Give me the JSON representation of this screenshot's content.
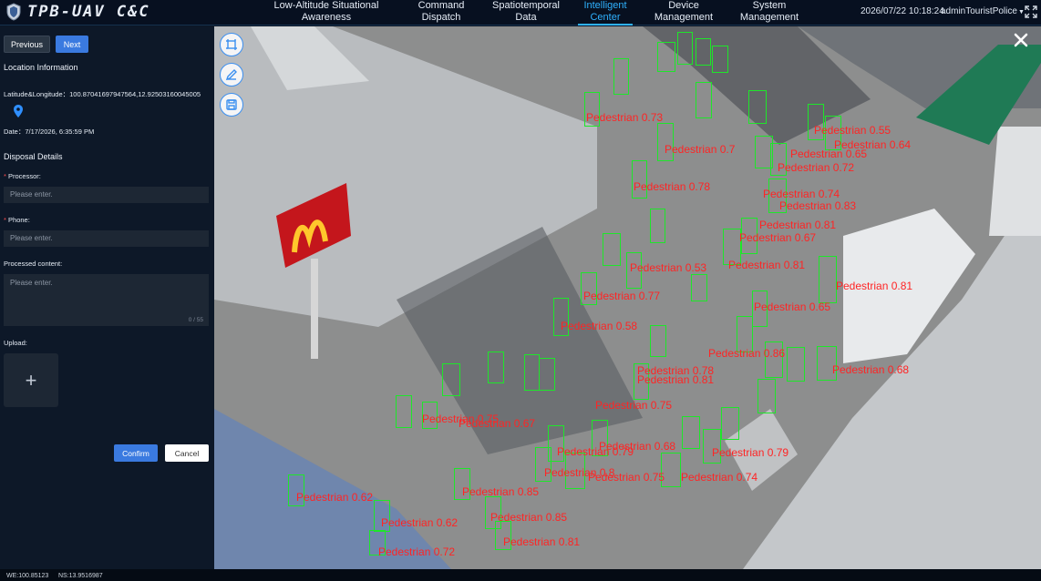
{
  "header": {
    "logo_text": "TPB-UAV  C&C",
    "nav": [
      {
        "line1": "Low-Altitude Situational",
        "line2": "Awareness"
      },
      {
        "line1": "Command",
        "line2": "Dispatch"
      },
      {
        "line1": "Spatiotemporal",
        "line2": "Data"
      },
      {
        "line1": "Intelligent",
        "line2": "Center"
      },
      {
        "line1": "Device",
        "line2": "Management"
      },
      {
        "line1": "System",
        "line2": "Management"
      }
    ],
    "datetime": "2026/07/22 10:18:24",
    "user": "adminTouristPolice"
  },
  "sidebar": {
    "prev_label": "Previous",
    "next_label": "Next",
    "location_title": "Location Information",
    "latlng_label": "Latitude&Longitude：",
    "latlng_value": "100.87041697947564,12.92503160045005",
    "date_label": "Date：",
    "date_value": "7/17/2026, 6:35:59 PM",
    "disposal_title": "Disposal Details",
    "processor_label": "Processor:",
    "processor_placeholder": "Please enter.",
    "phone_label": "Phone:",
    "phone_placeholder": "Please enter.",
    "content_label": "Processed content:",
    "content_placeholder": "Please enter.",
    "content_counter": "0 / 55",
    "upload_label": "Upload:",
    "upload_plus": "+",
    "confirm_label": "Confirm",
    "cancel_label": "Cancel"
  },
  "footer": {
    "we": "WE:100.85123",
    "ns": "NS:13.9516987"
  },
  "video": {
    "detections": [
      {
        "label": "Pedestrian 0.73"
      },
      {
        "label": "Pedestrian 0.7"
      },
      {
        "label": "Pedestrian 0.78"
      },
      {
        "label": "Pedestrian 0.55"
      },
      {
        "label": "Pedestrian 0.64"
      },
      {
        "label": "Pedestrian 0.65"
      },
      {
        "label": "Pedestrian 0.72"
      },
      {
        "label": "Pedestrian 0.74"
      },
      {
        "label": "Pedestrian 0.83"
      },
      {
        "label": "Pedestrian 0.81"
      },
      {
        "label": "Pedestrian 0.67"
      },
      {
        "label": "Pedestrian 0.53"
      },
      {
        "label": "Pedestrian 0.81"
      },
      {
        "label": "Pedestrian 0.77"
      },
      {
        "label": "Pedestrian 0.81"
      },
      {
        "label": "Pedestrian 0.65"
      },
      {
        "label": "Pedestrian 0.58"
      },
      {
        "label": "Pedestrian 0.86"
      },
      {
        "label": "Pedestrian 0.78"
      },
      {
        "label": "Pedestrian 0.81"
      },
      {
        "label": "Pedestrian 0.68"
      },
      {
        "label": "Pedestrian 0.75"
      },
      {
        "label": "Pedestrian 0.67"
      },
      {
        "label": "Pedestrian 0.75"
      },
      {
        "label": "Pedestrian 0.79"
      },
      {
        "label": "Pedestrian 0.68"
      },
      {
        "label": "Pedestrian 0.8"
      },
      {
        "label": "Pedestrian 0.75"
      },
      {
        "label": "Pedestrian 0.74"
      },
      {
        "label": "Pedestrian 0.79"
      },
      {
        "label": "Pedestrian 0.62"
      },
      {
        "label": "Pedestrian 0.85"
      },
      {
        "label": "Pedestrian 0.62"
      },
      {
        "label": "Pedestrian 0.85"
      },
      {
        "label": "Pedestrian 0.72"
      },
      {
        "label": "Pedestrian 0.81"
      }
    ]
  }
}
